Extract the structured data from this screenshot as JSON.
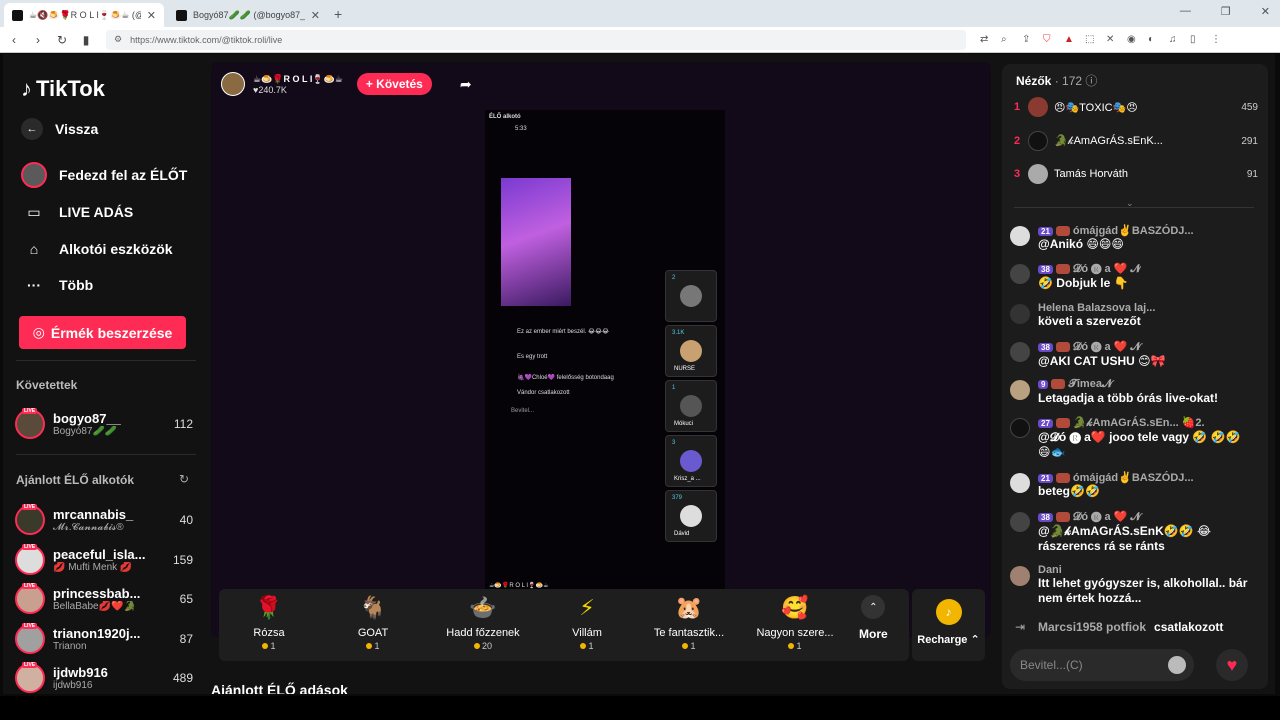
{
  "browser": {
    "tabs": [
      {
        "title": "☕🔇🍮🌹R O L I🍷🍮☕ (@tik..."
      },
      {
        "title": "Bogyó87🥒🥒 (@bogyo87_) ÉLŐ a..."
      }
    ],
    "url": "https://www.tiktok.com/@tiktok.roli/live"
  },
  "sidebar": {
    "logo": "TikTok",
    "back": "Vissza",
    "items": [
      {
        "label": "Fedezd fel az ÉLŐT"
      },
      {
        "label": "LIVE ADÁS"
      },
      {
        "label": "Alkotói eszközök"
      },
      {
        "label": "Több"
      }
    ],
    "coins_button": "Érmék beszerzése",
    "following_title": "Követettek",
    "following": [
      {
        "name": "bogyo87__",
        "sub": "Bogyó87🥒🥒",
        "count": "112"
      }
    ],
    "recommended_title": "Ajánlott ÉLŐ alkotók",
    "recommended": [
      {
        "name": "mrcannabis_",
        "sub": "𝓜𝓻.𝓒𝓪𝓷𝓷𝓪𝓫𝓲𝓼®",
        "count": "40"
      },
      {
        "name": "peaceful_isla...",
        "sub": "💋 Mufti Menk 💋",
        "count": "159"
      },
      {
        "name": "princessbab...",
        "sub": "BellaBabe💋❤️🐊",
        "count": "65"
      },
      {
        "name": "trianon1920j...",
        "sub": "Trianon",
        "count": "87"
      },
      {
        "name": "ijdwb916",
        "sub": "ijdwb916",
        "count": "489"
      }
    ],
    "live_badge": "LIVE"
  },
  "main": {
    "host_name": "☕🍮🌹R O L I🍷🍮☕",
    "host_likes": "♥240.7K",
    "follow_label": "+ Követés",
    "video_texts": {
      "live_label": "ÉLŐ alkotó",
      "time": "5:33",
      "chat1": "Ez az ember miért beszél. 😂😂😂",
      "chat2": "Es egy trott",
      "chat3": "🍇💜Chloé💜 felelősség botondaag",
      "chat4": "Vándor csatlakozott",
      "input": "Bevitel...",
      "footer": "☕🍮🌹R O L I🍷🍮☕"
    },
    "guests": [
      {
        "name": "",
        "count": "2"
      },
      {
        "name": "NURSE",
        "count": "3.1K"
      },
      {
        "name": "Mókuci",
        "count": "1"
      },
      {
        "name": "Krisz_a ...",
        "count": "3"
      },
      {
        "name": "Dávid",
        "count": "379"
      }
    ],
    "gifts": [
      {
        "icon": "🌹",
        "name": "Rózsa",
        "price": "1"
      },
      {
        "icon": "🐐",
        "name": "GOAT",
        "price": "1"
      },
      {
        "icon": "🍲",
        "name": "Hadd főzzenek",
        "price": "20"
      },
      {
        "icon": "⚡",
        "name": "Villám",
        "price": "1"
      },
      {
        "icon": "🐹",
        "name": "Te fantasztik...",
        "price": "1"
      },
      {
        "icon": "🥰",
        "name": "Nagyon szere...",
        "price": "1"
      }
    ],
    "more_label": "More",
    "recharge_label": "Recharge ⌃",
    "recommended_streams": "Ajánlott ÉLŐ adások"
  },
  "right": {
    "viewers_label": "Nézők",
    "viewers_count": "· 172",
    "ranking": [
      {
        "num": "1",
        "name": "😠🎭TOXIC🎭😠",
        "score": "459"
      },
      {
        "num": "2",
        "name": "🐊𝓀AmAGrÁS.sEnK...",
        "score": "291"
      },
      {
        "num": "3",
        "name": "Tamás Horváth",
        "score": "91"
      }
    ],
    "messages": [
      {
        "head": "ómájgád✌️BASZÓDJ...",
        "badge": "21",
        "text": "@Anikó 😄😄😄"
      },
      {
        "head": "𝓓ó 🅡 a ❤️ 𝓝",
        "badge": "38",
        "text": "🤣 Dobjuk le 👇"
      },
      {
        "head": "Helena Balazsova laj...",
        "badge": "",
        "text": "követi a szervezőt"
      },
      {
        "head": "𝓓ó 🅡 a ❤️ 𝓝",
        "badge": "38",
        "text": "@AKI CAT USHU 😊🎀"
      },
      {
        "head": "𝓣ímea𝓝",
        "badge": "9",
        "text": "Letagadja a több órás live-okat!"
      },
      {
        "head": "🐊𝓀AmAGrÁS.sEn... 🍓2.",
        "badge": "27",
        "text": "@𝓓ó 🅡 a❤️ jooo tele vagy 🤣 🤣🤣😄🐟"
      },
      {
        "head": "ómájgád✌️BASZÓDJ...",
        "badge": "21",
        "text": "beteg🤣🤣"
      },
      {
        "head": "𝓓ó 🅡 a ❤️ 𝓝",
        "badge": "38",
        "text": "@🐊𝓀AmAGrÁS.sEnK🤣🤣 😂 rászerencs rá se ránts"
      },
      {
        "head": "Dani",
        "badge": "",
        "text": "Itt lehet gyógyszer is, alkohollal.. bár nem értek hozzá..."
      }
    ],
    "joined_name": "Marcsi1958 potfiok",
    "joined_text": "csatlakozott",
    "input_placeholder": "Bevitel...(C)"
  }
}
